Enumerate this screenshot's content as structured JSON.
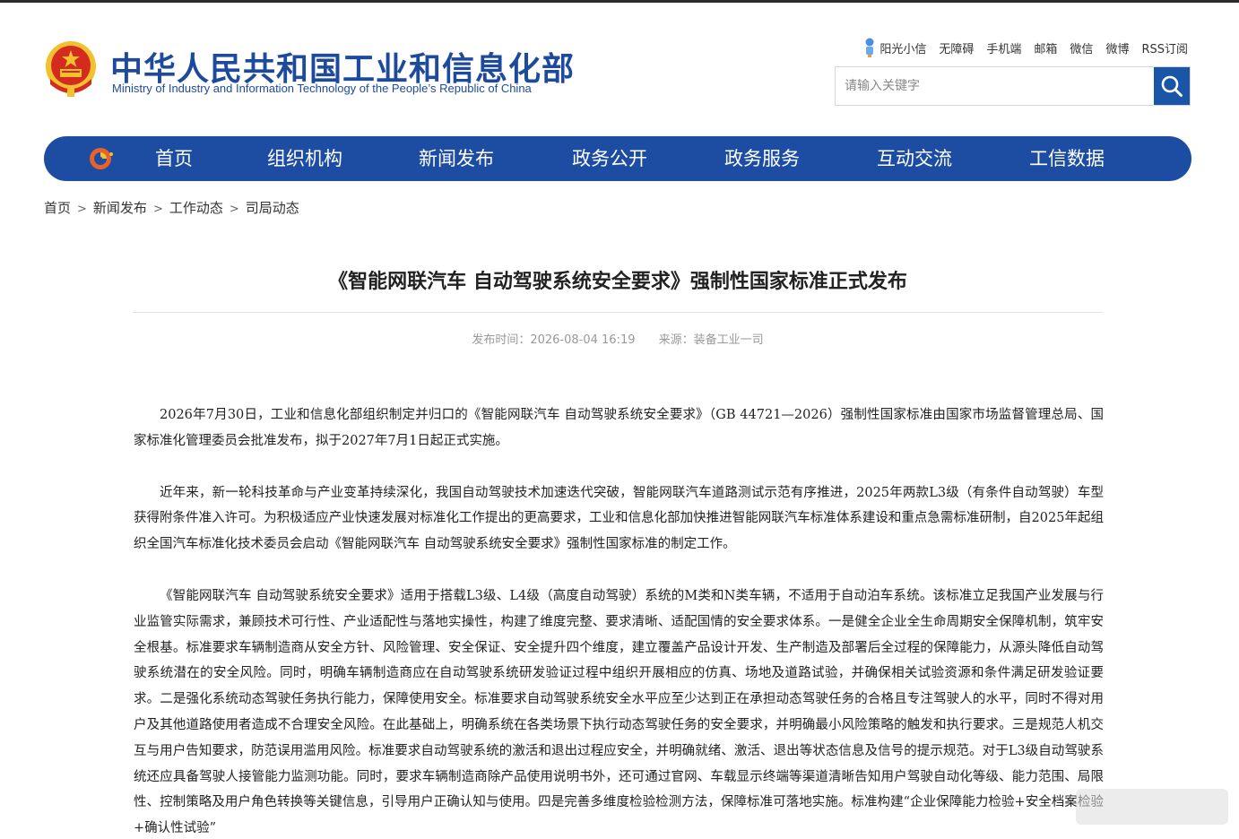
{
  "header": {
    "title_cn": "中华人民共和国工业和信息化部",
    "title_en": "Ministry of Industry and Information Technology of the People’s Republic of China",
    "toplinks": [
      "阳光小信",
      "无障碍",
      "手机端",
      "邮箱",
      "微信",
      "微博",
      "RSS订阅"
    ],
    "search_placeholder": "请输入关键字"
  },
  "nav": {
    "items": [
      "首页",
      "组织机构",
      "新闻发布",
      "政务公开",
      "政务服务",
      "互动交流",
      "工信数据"
    ]
  },
  "breadcrumb": [
    "首页",
    "新闻发布",
    "工作动态",
    "司局动态"
  ],
  "article": {
    "title": "《智能网联汽车 自动驾驶系统安全要求》强制性国家标准正式发布",
    "published": "发布时间：2026-08-04 16:19",
    "source": "来源：装备工业一司",
    "paragraphs": [
      "2026年7月30日，工业和信息化部组织制定并归口的《智能网联汽车 自动驾驶系统安全要求》（GB 44721—2026）强制性国家标准由国家市场监督管理总局、国家标准化管理委员会批准发布，拟于2027年7月1日起正式实施。",
      "近年来，新一轮科技革命与产业变革持续深化，我国自动驾驶技术加速迭代突破，智能网联汽车道路测试示范有序推进，2025年两款L3级（有条件自动驾驶）车型获得附条件准入许可。为积极适应产业快速发展对标准化工作提出的更高要求，工业和信息化部加快推进智能网联汽车标准体系建设和重点急需标准研制，自2025年起组织全国汽车标准化技术委员会启动《智能网联汽车 自动驾驶系统安全要求》强制性国家标准的制定工作。",
      "《智能网联汽车 自动驾驶系统安全要求》适用于搭载L3级、L4级（高度自动驾驶）系统的M类和N类车辆，不适用于自动泊车系统。该标准立足我国产业发展与行业监管实际需求，兼顾技术可行性、产业适配性与落地实操性，构建了维度完整、要求清晰、适配国情的安全要求体系。一是健全企业全生命周期安全保障机制，筑牢安全根基。标准要求车辆制造商从安全方针、风险管理、安全保证、安全提升四个维度，建立覆盖产品设计开发、生产制造及部署后全过程的保障能力，从源头降低自动驾驶系统潜在的安全风险。同时，明确车辆制造商应在自动驾驶系统研发验证过程中组织开展相应的仿真、场地及道路试验，并确保相关试验资源和条件满足研发验证要求。二是强化系统动态驾驶任务执行能力，保障使用安全。标准要求自动驾驶系统安全水平应至少达到正在承担动态驾驶任务的合格且专注驾驶人的水平，同时不得对用户及其他道路使用者造成不合理安全风险。在此基础上，明确系统在各类场景下执行动态驾驶任务的安全要求，并明确最小风险策略的触发和执行要求。三是规范人机交互与用户告知要求，防范误用滥用风险。标准要求自动驾驶系统的激活和退出过程应安全，并明确就绪、激活、退出等状态信息及信号的提示规范。对于L3级自动驾驶系统还应具备驾驶人接管能力监测功能。同时，要求车辆制造商除产品使用说明书外，还可通过官网、车载显示终端等渠道清晰告知用户驾驶自动化等级、能力范围、局限性、控制策略及用户角色转换等关键信息，引导用户正确认知与使用。四是完善多维度检验检测方法，保障标准可落地实施。标准构建“企业保障能力检验+安全档案检验+确认性试验”"
    ]
  },
  "colors": {
    "brand_blue": "#1d4da3",
    "title_blue": "#1d4a9c",
    "search_button": "#1a56a8",
    "emblem_red": "#d42a1f",
    "emblem_gold": "#f2c12e"
  }
}
